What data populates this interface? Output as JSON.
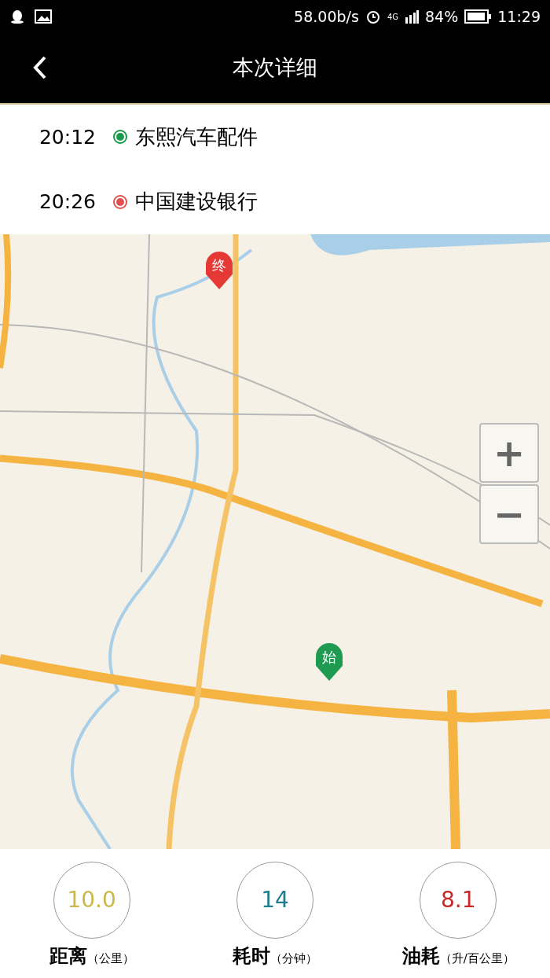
{
  "status_bar": {
    "speed": "58.00b/s",
    "network": "4G",
    "battery": "84%",
    "time": "11:29"
  },
  "header": {
    "title": "本次详细"
  },
  "stops": [
    {
      "time": "20:12",
      "name": "东熙汽车配件",
      "color": "#1a9a4a"
    },
    {
      "time": "20:26",
      "name": "中国建设银行",
      "color": "#e05050"
    }
  ],
  "map": {
    "pins": [
      {
        "kind": "end",
        "label": "终",
        "color": "#e53935"
      },
      {
        "kind": "start",
        "label": "始",
        "color": "#1e9b50"
      }
    ],
    "zoom_in": "+",
    "zoom_out": "−"
  },
  "stats": [
    {
      "value": "10.0",
      "label": "距离",
      "unit": "（公里）",
      "color": "#c9b84a"
    },
    {
      "value": "14",
      "label": "耗时",
      "unit": "（分钟）",
      "color": "#1f7f8f"
    },
    {
      "value": "8.1",
      "label": "油耗",
      "unit": "（升/百公里）",
      "color": "#c62828"
    }
  ]
}
